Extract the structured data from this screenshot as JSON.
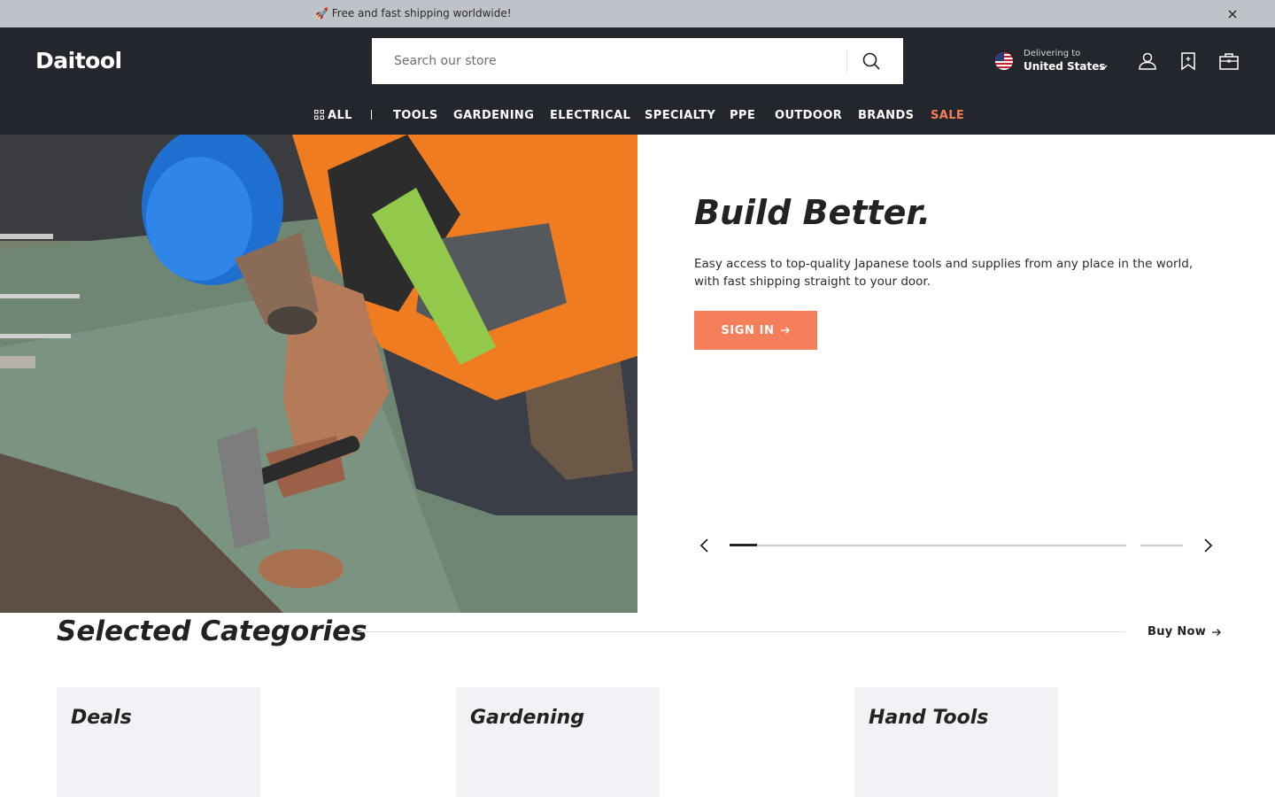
{
  "announcement": {
    "text": "🚀 Free and fast shipping worldwide!"
  },
  "header": {
    "logo": "Daitool",
    "search": {
      "placeholder": "Search our store"
    },
    "delivery": {
      "label": "Delivering to",
      "country": "United States"
    },
    "icons": [
      "user-icon",
      "bookmark-icon",
      "shopping-bag-icon"
    ]
  },
  "nav": {
    "items": [
      "ALL",
      "TOOLS",
      "GARDENING",
      "ELECTRICAL",
      "SPECIALTY",
      "PPE",
      "OUTDOOR",
      "BRANDS",
      "SALE"
    ]
  },
  "hero": {
    "title": "Build Better.",
    "description": "Easy access to top-quality Japanese tools and supplies from any place in the world, with fast shipping straight to your door.",
    "cta": "SIGN IN",
    "slide_progress": 0.07,
    "slide_count": 2
  },
  "categories": {
    "title": "Selected Categories",
    "link": "Buy Now",
    "cards": [
      "Deals",
      "Gardening",
      "Hand Tools"
    ]
  },
  "colors": {
    "header_bg": "#23262c",
    "accent": "#f67f5b",
    "announce_bg": "#bfc3c9",
    "card_bg": "#f0f2f5"
  }
}
